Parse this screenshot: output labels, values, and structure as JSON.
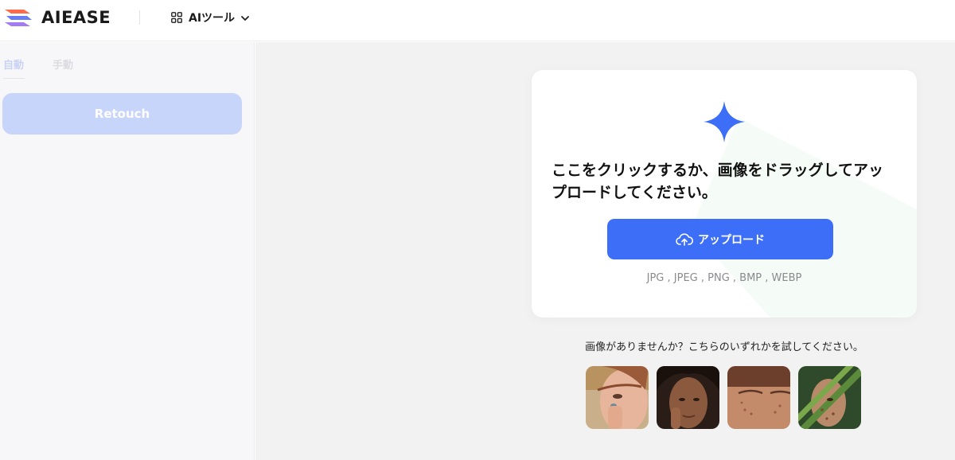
{
  "header": {
    "brand": "AIEASE",
    "tools_label": "AIツール"
  },
  "sidebar": {
    "tabs": [
      "自動",
      "手動"
    ],
    "retouch_label": "Retouch"
  },
  "upload": {
    "prompt": "ここをクリックするか、画像をドラッグしてアップロードしてください。",
    "button_label": "アップロード",
    "formats": "JPG , JPEG , PNG , BMP , WEBP"
  },
  "samples": {
    "prompt": "画像がありませんか？こちらのいずれかを試してください。",
    "images": [
      "sample-face-1",
      "sample-face-2",
      "sample-face-3",
      "sample-face-4"
    ]
  },
  "colors": {
    "accent": "#3d6ef8",
    "retouch_disabled": "#c8d5fa"
  }
}
